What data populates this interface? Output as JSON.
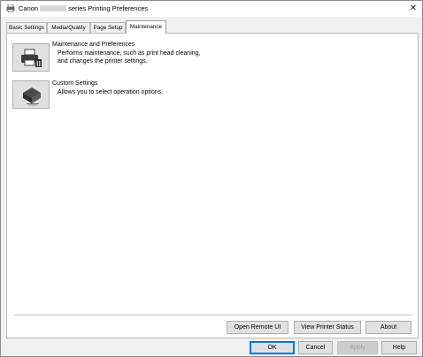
{
  "window": {
    "title_prefix": "Canon",
    "title_suffix": "series Printing Preferences",
    "close_glyph": "✕"
  },
  "tabs": [
    {
      "label": "Basic Settings",
      "active": false
    },
    {
      "label": "Media/Quality",
      "active": false
    },
    {
      "label": "Page Setup",
      "active": false
    },
    {
      "label": "Maintenance",
      "active": true
    }
  ],
  "maintenance": {
    "items": [
      {
        "title": "Maintenance and Preferences",
        "desc_line1": "Performs maintenance, such as print head cleaning,",
        "desc_line2": "and changes the printer settings.",
        "icon": "printer-maintenance-icon"
      },
      {
        "title": "Custom Settings",
        "desc_line1": "Allows you to select operation options.",
        "icon": "printer-custom-settings-icon"
      }
    ],
    "buttons": {
      "open_remote_ui": "Open Remote UI",
      "view_printer_status": "View Printer Status",
      "about": "About"
    }
  },
  "footer": {
    "ok": "OK",
    "cancel": "Cancel",
    "apply": "Apply",
    "help": "Help"
  },
  "colors": {
    "focus_border": "#0078d7",
    "panel_bg": "#ffffff",
    "dialog_bg": "#f0f0f0"
  }
}
